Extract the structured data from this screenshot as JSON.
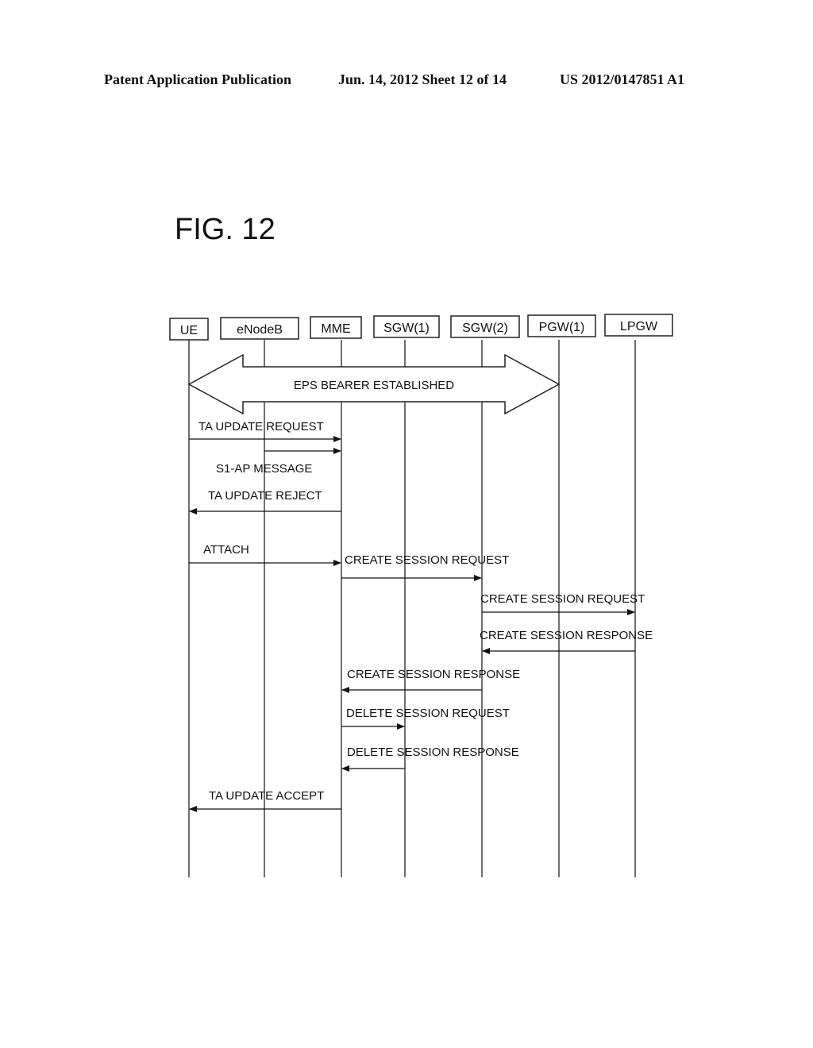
{
  "header": {
    "publication": "Patent Application Publication",
    "date_sheet": "Jun. 14, 2012  Sheet 12 of 14",
    "number": "US 2012/0147851 A1"
  },
  "figure_label": "FIG. 12",
  "entities": [
    "UE",
    "eNodeB",
    "MME",
    "SGW(1)",
    "SGW(2)",
    "PGW(1)",
    "LPGW"
  ],
  "bearer": {
    "label": "EPS BEARER ESTABLISHED",
    "from": "UE",
    "to": "PGW(1)"
  },
  "messages": [
    {
      "label": "TA UPDATE REQUEST",
      "from": "UE",
      "to": "MME"
    },
    {
      "label": "S1-AP MESSAGE",
      "from": "eNodeB",
      "to": "MME"
    },
    {
      "label": "TA UPDATE REJECT",
      "from": "MME",
      "to": "UE"
    },
    {
      "label": "ATTACH",
      "from": "UE",
      "to": "MME"
    },
    {
      "label": "CREATE SESSION REQUEST",
      "from": "MME",
      "to": "SGW(2)"
    },
    {
      "label": "CREATE SESSION REQUEST",
      "from": "SGW(2)",
      "to": "LPGW"
    },
    {
      "label": "CREATE SESSION RESPONSE",
      "from": "LPGW",
      "to": "SGW(2)"
    },
    {
      "label": "CREATE SESSION RESPONSE",
      "from": "SGW(2)",
      "to": "MME"
    },
    {
      "label": "DELETE SESSION REQUEST",
      "from": "MME",
      "to": "SGW(1)"
    },
    {
      "label": "DELETE SESSION RESPONSE",
      "from": "SGW(1)",
      "to": "MME"
    },
    {
      "label": "TA UPDATE ACCEPT",
      "from": "MME",
      "to": "UE"
    }
  ]
}
